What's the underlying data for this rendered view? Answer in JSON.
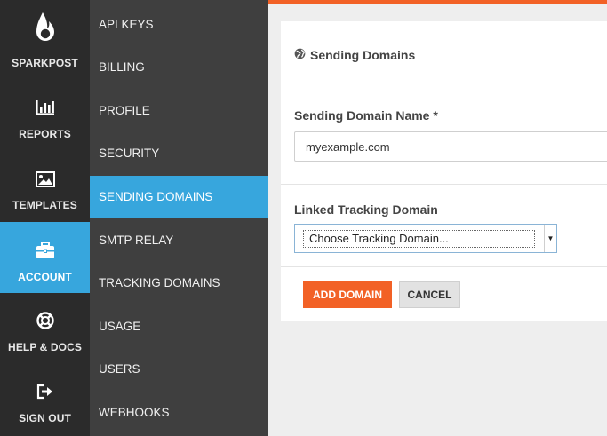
{
  "brand": {
    "name": "SPARKPOST",
    "accent": "#f26126",
    "active": "#37a6dd"
  },
  "rail": {
    "items": [
      {
        "label": "REPORTS",
        "icon": "bar-chart-icon"
      },
      {
        "label": "TEMPLATES",
        "icon": "image-icon"
      },
      {
        "label": "ACCOUNT",
        "icon": "briefcase-icon",
        "active": true
      },
      {
        "label": "HELP & DOCS",
        "icon": "life-ring-icon"
      },
      {
        "label": "SIGN OUT",
        "icon": "sign-out-icon"
      }
    ]
  },
  "submenu": {
    "items": [
      {
        "label": "API KEYS"
      },
      {
        "label": "BILLING"
      },
      {
        "label": "PROFILE"
      },
      {
        "label": "SECURITY"
      },
      {
        "label": "SENDING DOMAINS",
        "active": true
      },
      {
        "label": "SMTP RELAY"
      },
      {
        "label": "TRACKING DOMAINS"
      },
      {
        "label": "USAGE"
      },
      {
        "label": "USERS"
      },
      {
        "label": "WEBHOOKS"
      }
    ]
  },
  "panel": {
    "title": "Sending Domains",
    "title_icon": "globe-icon",
    "domain_name_label": "Sending Domain Name *",
    "domain_name_value": "myexample.com",
    "tracking_label": "Linked Tracking Domain",
    "tracking_selected": "Choose Tracking Domain...",
    "add_button": "ADD DOMAIN",
    "cancel_button": "CANCEL"
  }
}
